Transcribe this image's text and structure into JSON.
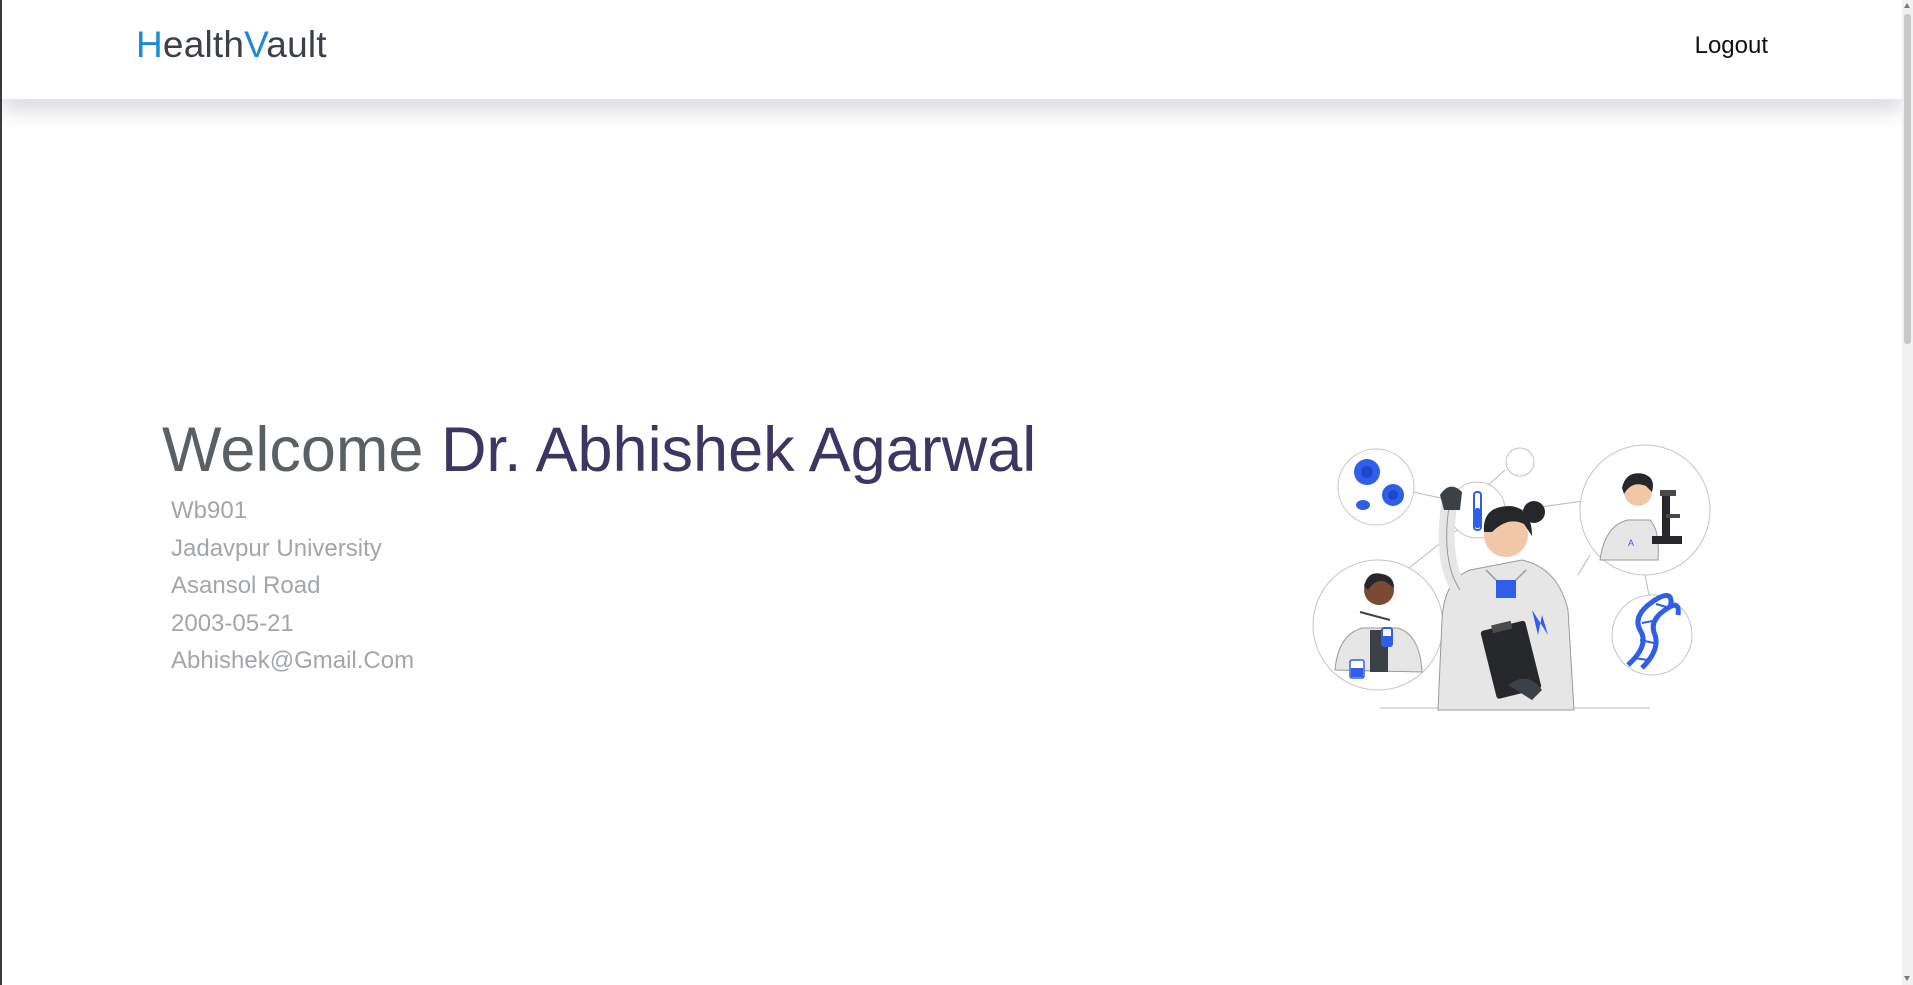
{
  "brand": {
    "letter1": "H",
    "part1": "ealth",
    "letter2": "V",
    "part2": "ault"
  },
  "nav": {
    "logout_label": "Logout"
  },
  "welcome": {
    "greeting": "Welcome",
    "doctor_name": "Dr. Abhishek Agarwal"
  },
  "doctor": {
    "id": "Wb901",
    "university": "Jadavpur University",
    "address": "Asansol Road",
    "dob": "2003-05-21",
    "email": "Abhishek@Gmail.Com"
  },
  "illustration": {
    "icon": "scientists-illustration",
    "accent_color": "#2f5ee8",
    "dark_color": "#26272b",
    "coat_color": "#e6e6e6"
  }
}
